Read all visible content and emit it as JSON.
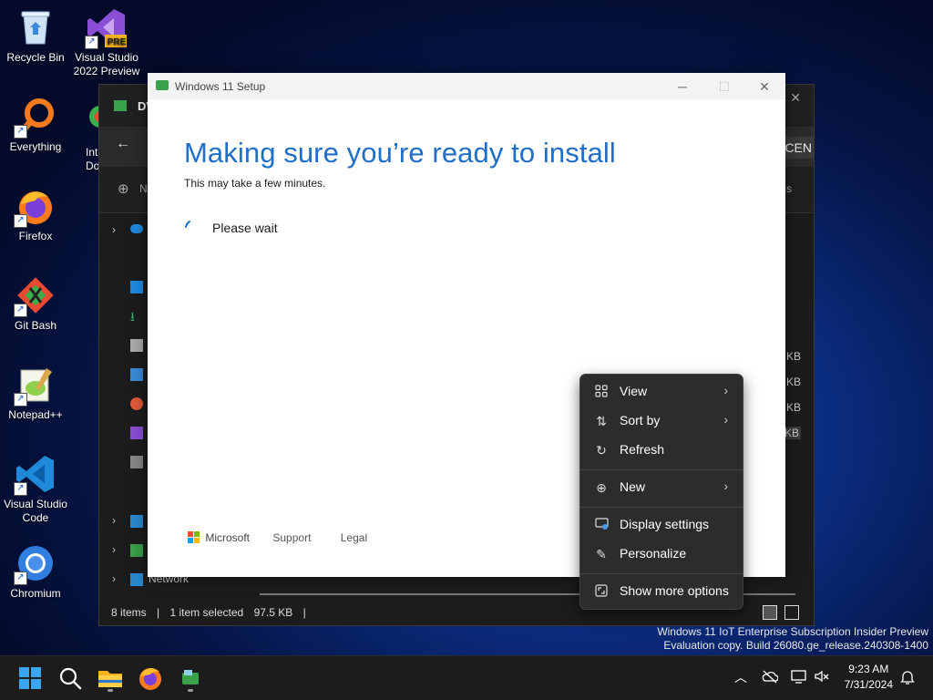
{
  "desktop": {
    "icons": [
      {
        "label": "Recycle Bin",
        "icon": "recycle-bin-icon"
      },
      {
        "label": "Visual Studio 2022 Preview",
        "badge": "PRE",
        "icon": "visual-studio-icon"
      },
      {
        "label": "Everything",
        "icon": "everything-icon"
      },
      {
        "label": "Int Do",
        "icon": "internet-download-icon"
      },
      {
        "label": "Firefox",
        "icon": "firefox-icon"
      },
      {
        "label": "Git Bash",
        "icon": "git-bash-icon"
      },
      {
        "label": "Notepad++",
        "icon": "notepadpp-icon"
      },
      {
        "label": "Visual Studio Code",
        "icon": "vscode-icon"
      },
      {
        "label": "Chromium",
        "icon": "chromium-icon"
      }
    ]
  },
  "explorer": {
    "title_partial": "DV",
    "address_partial": "CEN",
    "cmd_new_partial": "N",
    "cmd_right_partial": "s",
    "network_label": "Network",
    "file_sizes": [
      "KB",
      "KB",
      "KB",
      "KB"
    ],
    "status": {
      "items": "8 items",
      "selected": "1 item selected",
      "size": "97.5 KB"
    }
  },
  "setup": {
    "window_title": "Windows 11 Setup",
    "heading": "Making sure you’re ready to install",
    "subtitle": "This may take a few minutes.",
    "status_text": "Please wait",
    "footer": {
      "brand": "Microsoft",
      "support": "Support",
      "legal": "Legal"
    }
  },
  "context_menu": {
    "items": [
      {
        "label": "View",
        "icon": "grid-icon",
        "submenu": true
      },
      {
        "label": "Sort by",
        "icon": "sort-icon",
        "submenu": true
      },
      {
        "label": "Refresh",
        "icon": "refresh-icon",
        "submenu": false
      },
      {
        "label": "New",
        "icon": "plus-circle-icon",
        "submenu": true
      },
      {
        "label": "Display settings",
        "icon": "display-icon",
        "submenu": false
      },
      {
        "label": "Personalize",
        "icon": "pen-icon",
        "submenu": false
      },
      {
        "label": "Show more options",
        "icon": "expand-icon",
        "submenu": false
      }
    ]
  },
  "watermark": {
    "line1": "Windows 11 IoT Enterprise Subscription Insider Preview",
    "line2": "Evaluation copy. Build 26080.ge_release.240308-1400"
  },
  "taskbar": {
    "apps": [
      "start-icon",
      "search-icon",
      "file-explorer-icon",
      "firefox-icon",
      "setup-icon"
    ],
    "time": "9:23 AM",
    "date": "7/31/2024"
  },
  "colors": {
    "accent": "#1f6ec8",
    "menu_bg": "#2c2c2c",
    "taskbar_bg": "#1c1c1c"
  }
}
